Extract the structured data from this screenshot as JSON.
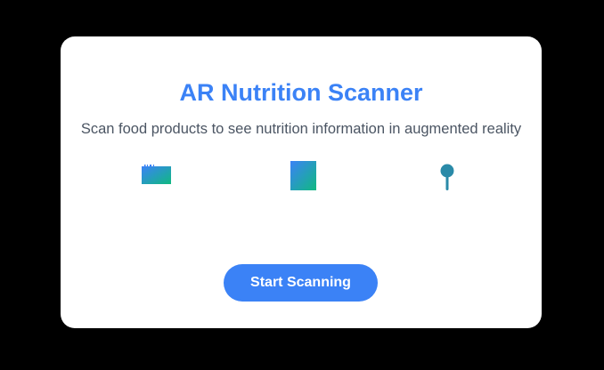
{
  "card": {
    "title": "AR Nutrition Scanner",
    "subtitle": "Scan food products to see nutrition information in augmented reality"
  },
  "icons": [
    {
      "name": "barcode-icon"
    },
    {
      "name": "package-icon"
    },
    {
      "name": "location-pin-icon"
    }
  ],
  "actions": {
    "start_label": "Start Scanning"
  },
  "colors": {
    "accent": "#3b82f6",
    "icon_gradient_start": "#3b82f6",
    "icon_gradient_end": "#10b981",
    "subtitle_text": "#4b5563"
  }
}
